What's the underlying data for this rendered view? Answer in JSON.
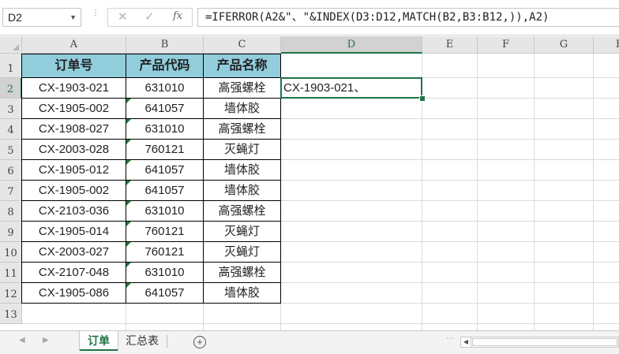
{
  "formula_bar": {
    "name_box": "D2",
    "cancel_icon": "✕",
    "enter_icon": "✓",
    "fx_label": "fx",
    "formula": "=IFERROR(A2&\"、\"&INDEX(D3:D12,MATCH(B2,B3:B12,)),A2)"
  },
  "columns": [
    "A",
    "B",
    "C",
    "D",
    "E",
    "F",
    "G",
    "H"
  ],
  "active_column": "D",
  "rows": [
    "1",
    "2",
    "3",
    "4",
    "5",
    "6",
    "7",
    "8",
    "9",
    "10",
    "11",
    "12",
    "13"
  ],
  "active_row": "2",
  "table": {
    "headers": [
      "订单号",
      "产品代码",
      "产品名称"
    ],
    "rows": [
      [
        "CX-1903-021",
        "631010",
        "高强螺栓"
      ],
      [
        "CX-1905-002",
        "641057",
        "墙体胶"
      ],
      [
        "CX-1908-027",
        "631010",
        "高强螺栓"
      ],
      [
        "CX-2003-028",
        "760121",
        "灭蝇灯"
      ],
      [
        "CX-1905-012",
        "641057",
        "墙体胶"
      ],
      [
        "CX-1905-002",
        "641057",
        "墙体胶"
      ],
      [
        "CX-2103-036",
        "631010",
        "高强螺栓"
      ],
      [
        "CX-1905-014",
        "760121",
        "灭蝇灯"
      ],
      [
        "CX-2003-027",
        "760121",
        "灭蝇灯"
      ],
      [
        "CX-2107-048",
        "631010",
        "高强螺栓"
      ],
      [
        "CX-1905-086",
        "641057",
        "墙体胶"
      ]
    ],
    "header_fill": "#92cddc"
  },
  "cell_D2": "CX-1903-021、",
  "sheets": {
    "active": "订单",
    "others": [
      "汇总表"
    ],
    "add_icon": "+"
  },
  "colors": {
    "accent": "#217346",
    "error_indicator": "#1e7e34"
  }
}
